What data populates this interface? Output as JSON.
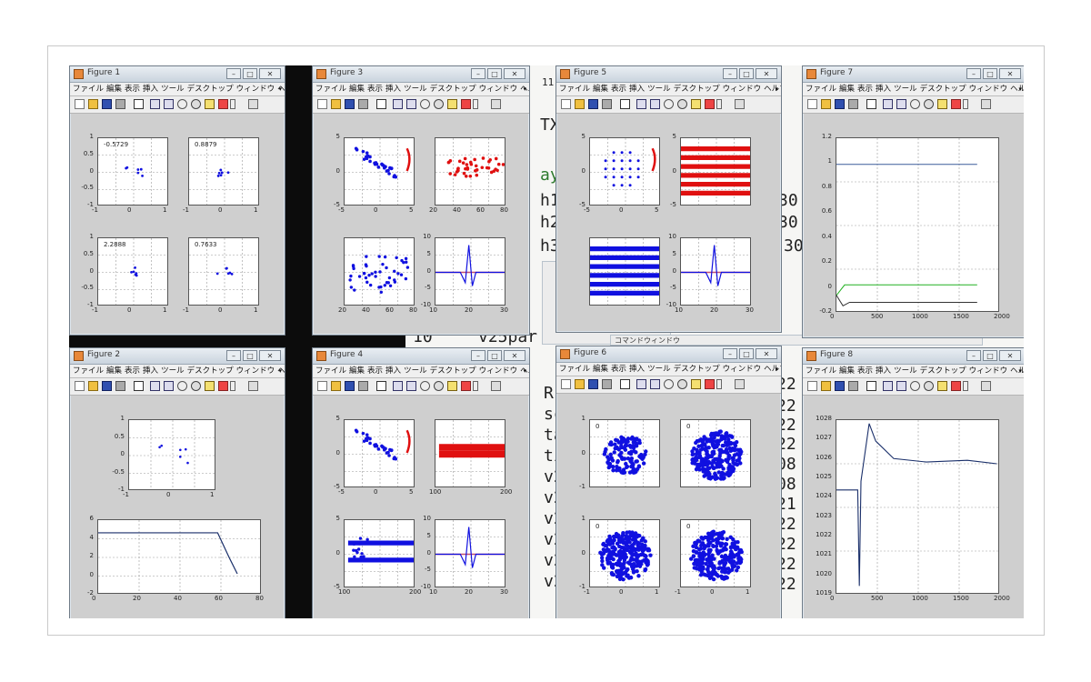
{
  "menu": [
    "ファイル",
    "編集",
    "表示",
    "挿入",
    "ツール",
    "デスクトップ",
    "ウィンドウ",
    "ヘルプ"
  ],
  "background_editor": {
    "lines": [
      "TX",
      "ay",
      "h1",
      "h2",
      "h3",
      "v2"
    ],
    "right_digits": [
      "30",
      "30",
      "30"
    ],
    "lower_lines": [
      "R",
      "sc",
      "ta",
      "tir",
      "v2",
      "v2",
      "v2",
      "v2",
      "v2",
      "v2"
    ],
    "lower_right": [
      "22",
      "22",
      "22",
      "22",
      "08",
      "08",
      "21",
      "22",
      "22",
      "22",
      "22"
    ],
    "partial_line": "v25par",
    "left_number": "10",
    "top_number": "11",
    "panel_title": "コマンドウィンドウ"
  },
  "figures": [
    {
      "id": "fig1",
      "title": "Figure 1",
      "axes": [
        {
          "annotation": "-0.5729",
          "xticks": [
            "-1",
            "0",
            "1"
          ],
          "yticks": [
            "1",
            "0.5",
            "0",
            "-0.5",
            "-1"
          ]
        },
        {
          "annotation": "0.8879",
          "xticks": [
            "-1",
            "0",
            "1"
          ],
          "yticks": []
        },
        {
          "annotation": "2.2888",
          "xticks": [
            "-1",
            "0",
            "1"
          ],
          "yticks": [
            "1",
            "0.5",
            "0",
            "-0.5",
            "-1"
          ]
        },
        {
          "annotation": "0.7633",
          "xticks": [
            "-1",
            "0",
            "1"
          ],
          "yticks": []
        }
      ]
    },
    {
      "id": "fig3",
      "title": "Figure 3",
      "axes": [
        {
          "xticks": [
            "-5",
            "0",
            "5"
          ],
          "yticks": [
            "5",
            "0",
            "-5"
          ]
        },
        {
          "xticks": [
            "20",
            "40",
            "60",
            "80"
          ],
          "yticks": []
        },
        {
          "xticks": [
            "20",
            "40",
            "60",
            "80"
          ],
          "yticks": []
        },
        {
          "xticks": [
            "10",
            "20",
            "30"
          ],
          "yticks": [
            "10",
            "5",
            "0",
            "-5",
            "-10"
          ]
        }
      ]
    },
    {
      "id": "fig5",
      "title": "Figure 5",
      "axes": [
        {
          "xticks": [
            "-5",
            "0",
            "5"
          ],
          "yticks": [
            "5",
            "0",
            "-5"
          ]
        },
        {
          "xticks": [],
          "yticks": [
            "5",
            "0",
            "-5"
          ]
        },
        {
          "xticks": [],
          "yticks": []
        },
        {
          "xticks": [
            "10",
            "20",
            "30"
          ],
          "yticks": [
            "10",
            "5",
            "0",
            "-5",
            "-10"
          ]
        }
      ]
    },
    {
      "id": "fig7",
      "title": "Figure 7",
      "axes": [
        {
          "xticks": [
            "0",
            "500",
            "1000",
            "1500",
            "2000"
          ],
          "yticks": [
            "1.2",
            "1",
            "0.8",
            "0.6",
            "0.4",
            "0.2",
            "0",
            "-0.2"
          ]
        }
      ]
    },
    {
      "id": "fig2",
      "title": "Figure 2",
      "axes": [
        {
          "xticks": [
            "-1",
            "0",
            "1"
          ],
          "yticks": [
            "1",
            "0.5",
            "0",
            "-0.5",
            "-1"
          ]
        },
        {
          "xticks": [
            "0",
            "20",
            "40",
            "60",
            "80"
          ],
          "yticks": [
            "6",
            "4",
            "2",
            "0",
            "-2"
          ]
        }
      ]
    },
    {
      "id": "fig4",
      "title": "Figure 4",
      "axes": [
        {
          "xticks": [
            "-5",
            "0",
            "5"
          ],
          "yticks": [
            "5",
            "0",
            "-5"
          ]
        },
        {
          "xticks": [
            "100",
            "200"
          ],
          "yticks": []
        },
        {
          "xticks": [
            "100",
            "200"
          ],
          "yticks": [
            "5",
            "0",
            "-5"
          ]
        },
        {
          "xticks": [
            "10",
            "20",
            "30"
          ],
          "yticks": [
            "10",
            "5",
            "0",
            "-5",
            "-10"
          ]
        }
      ]
    },
    {
      "id": "fig6",
      "title": "Figure 6",
      "axes": [
        {
          "annotation": "0",
          "xticks": [],
          "yticks": [
            "1",
            "0",
            "-1"
          ]
        },
        {
          "annotation": "0",
          "xticks": [],
          "yticks": []
        },
        {
          "annotation": "0",
          "xticks": [
            "-1",
            "0",
            "1"
          ],
          "yticks": [
            "1",
            "0",
            "-1"
          ]
        },
        {
          "annotation": "0",
          "xticks": [
            "-1",
            "0",
            "1"
          ],
          "yticks": []
        }
      ]
    },
    {
      "id": "fig8",
      "title": "Figure 8",
      "axes": [
        {
          "xticks": [
            "0",
            "500",
            "1000",
            "1500",
            "2000"
          ],
          "yticks": [
            "1028",
            "1027",
            "1026",
            "1025",
            "1024",
            "1023",
            "1022",
            "1021",
            "1020",
            "1019"
          ]
        }
      ]
    }
  ],
  "colors": {
    "blue": "#1010e0",
    "red": "#e01010",
    "green": "#20b020",
    "darkline": "#1a2f6a"
  }
}
